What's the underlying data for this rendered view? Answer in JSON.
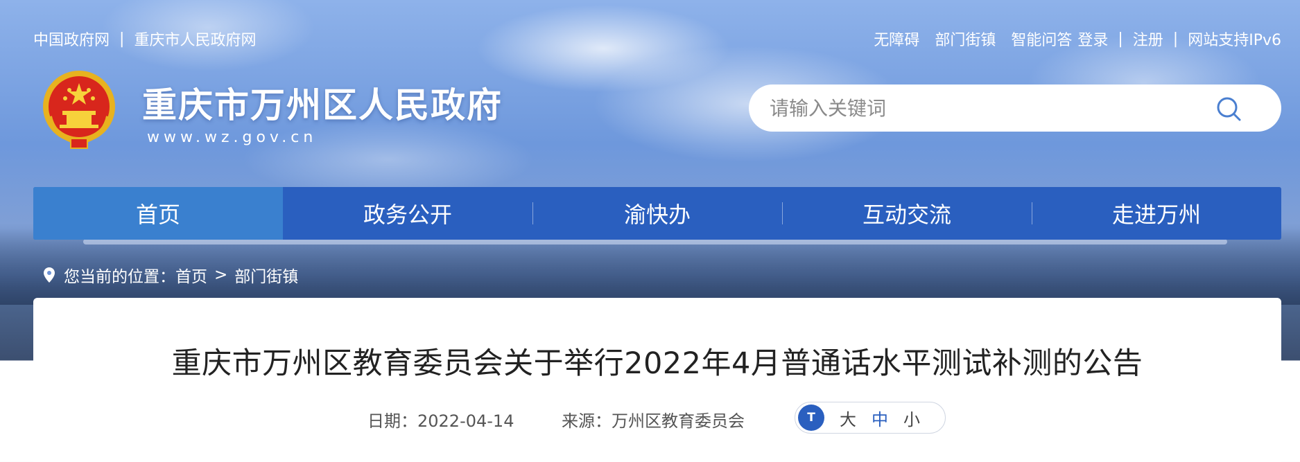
{
  "top_links_left": [
    "中国政府网",
    "重庆市人民政府网"
  ],
  "top_links_right": {
    "accessibility": "无障碍",
    "departments": "部门街镇",
    "smart_qa": "智能问答",
    "login": "登录",
    "register": "注册",
    "ipv6": "网站支持IPv6"
  },
  "site": {
    "title": "重庆市万州区人民政府",
    "url": "www.wz.gov.cn"
  },
  "search": {
    "placeholder": "请输入关键词"
  },
  "nav": {
    "items": [
      "首页",
      "政务公开",
      "渝快办",
      "互动交流",
      "走进万州"
    ],
    "active": "首页"
  },
  "breadcrumb": {
    "label": "您当前的位置：",
    "items": [
      "首页",
      "部门街镇"
    ],
    "separator": ">"
  },
  "article": {
    "title": "重庆市万州区教育委员会关于举行2022年4月普通话水平测试补测的公告",
    "date_label": "日期：2022-04-14",
    "source_label": "来源：万州区教育委员会"
  },
  "font_size": {
    "icon_label": "T",
    "options": [
      "大",
      "中",
      "小"
    ],
    "selected": "中"
  },
  "colors": {
    "nav_bg": "#2a5fbf",
    "nav_active": "#3a80cf",
    "accent": "#2a5fbf"
  }
}
